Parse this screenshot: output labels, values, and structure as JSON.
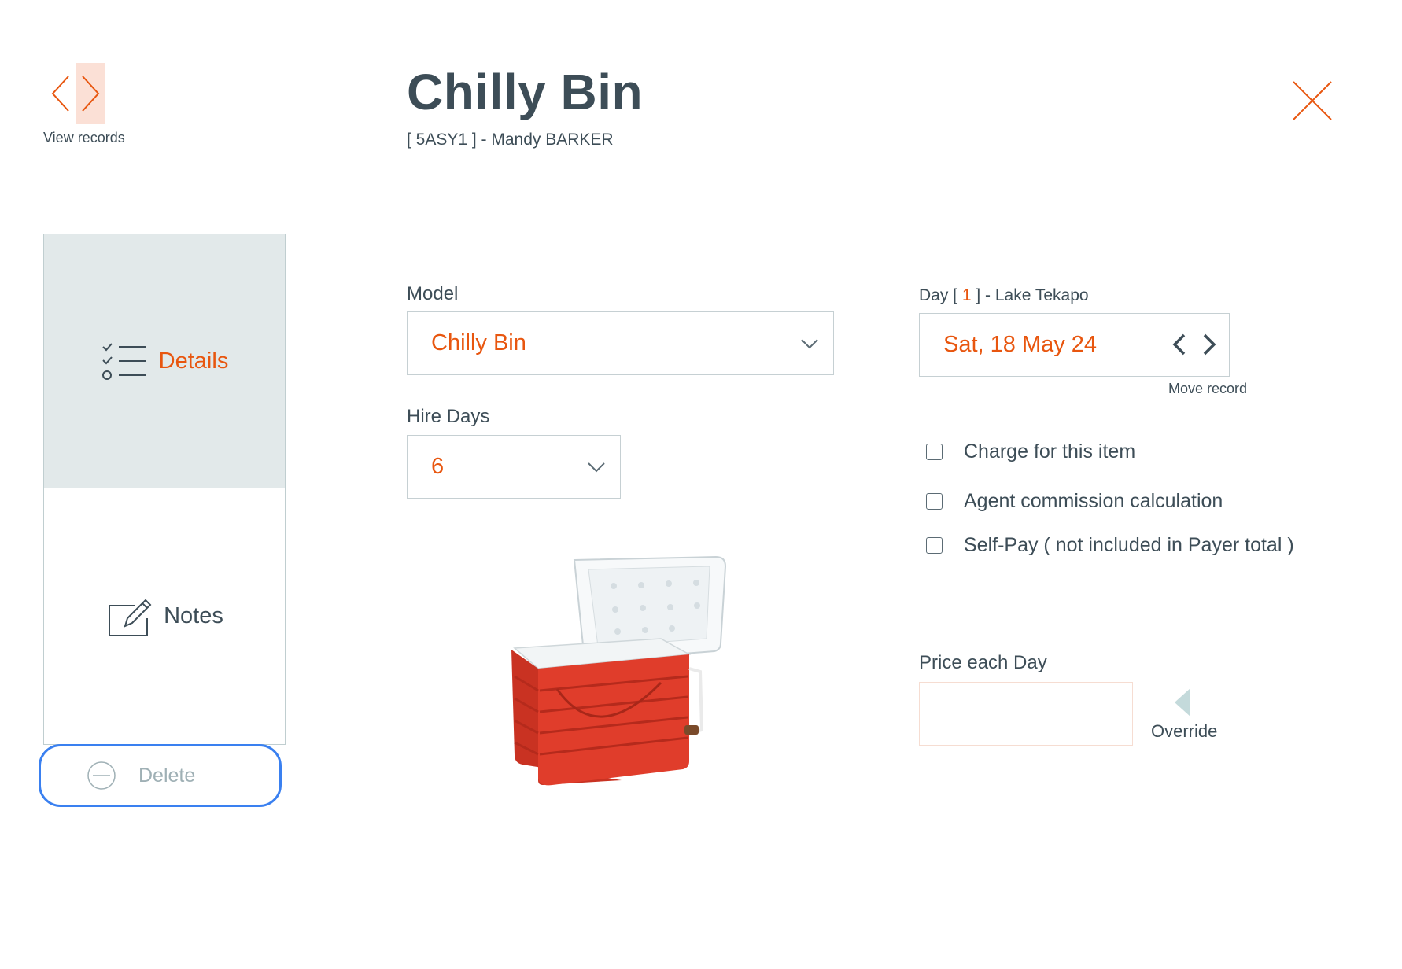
{
  "header": {
    "view_records_label": "View records",
    "title": "Chilly Bin",
    "subtitle": "[ 5ASY1 ] - Mandy BARKER"
  },
  "tabs": [
    {
      "label": "Details",
      "icon": "checklist-icon",
      "active": true
    },
    {
      "label": "Notes",
      "icon": "edit-note-icon",
      "active": false
    }
  ],
  "delete": {
    "label": "Delete",
    "icon": "minus-circle-icon"
  },
  "form": {
    "model_label": "Model",
    "model_value": "Chilly Bin",
    "hire_days_label": "Hire Days",
    "hire_days_value": "6",
    "day_label_prefix": "Day [ ",
    "day_number": "1",
    "day_label_suffix": " ] - Lake Tekapo",
    "date_value": "Sat, 18 May 24",
    "move_record_label": "Move record",
    "checkboxes": [
      {
        "label": "Charge for this item",
        "checked": false
      },
      {
        "label": "Agent commission calculation",
        "checked": false
      },
      {
        "label": "Self-Pay ( not included in Payer total )",
        "checked": false
      }
    ],
    "price_label": "Price each Day",
    "price_value": "",
    "override_label": "Override"
  },
  "colors": {
    "accent": "#e8560f",
    "text": "#3d4d57",
    "active_tab_bg": "#e2e9ea",
    "focus_ring": "#3a80f0"
  }
}
